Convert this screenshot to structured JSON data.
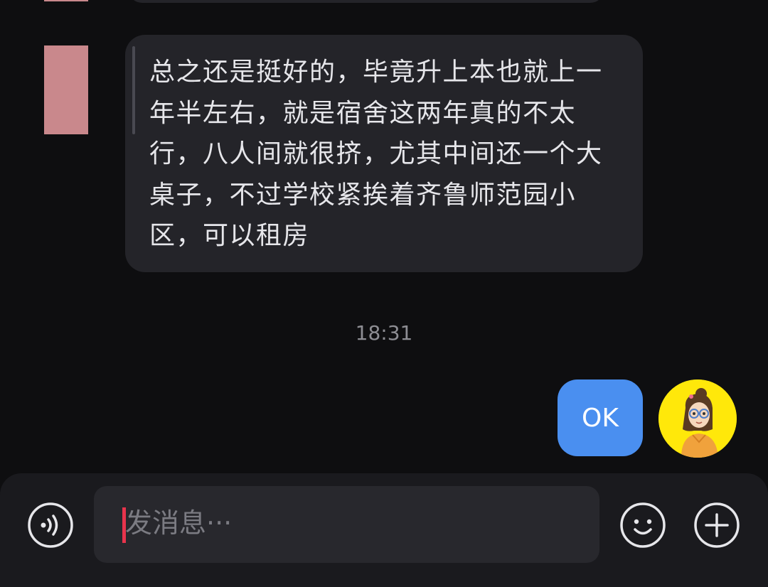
{
  "conversation": {
    "incoming_message": {
      "text": "总之还是挺好的，毕竟升上本也就上一年半左右，就是宿舍这两年真的不太行，八人间就很挤，尤其中间还一个大桌子，不过学校紧挨着齐鲁师范园小区，可以租房"
    },
    "timestamp": "18:31",
    "outgoing_message": {
      "text": "OK"
    }
  },
  "composer": {
    "placeholder": "发消息···",
    "voice_icon": "voice-waves-icon",
    "emoji_icon": "smiley-icon",
    "plus_icon": "plus-circle-icon"
  },
  "colors": {
    "background": "#0e0e10",
    "incoming_bubble": "#242429",
    "outgoing_bubble": "#4a8ff0",
    "caret": "#e8344c",
    "avatar_left": "#c9888c",
    "avatar_right_bg": "#ffe80a"
  }
}
